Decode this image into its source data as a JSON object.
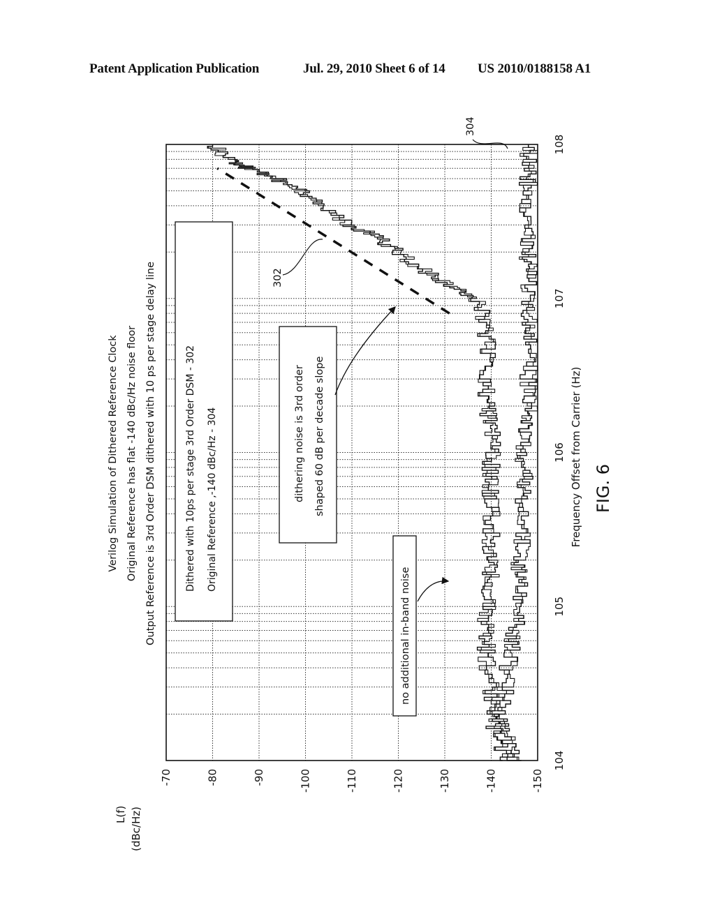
{
  "header": {
    "publication": "Patent Application Publication",
    "date_sheet": "Jul. 29, 2010   Sheet 6 of 14",
    "number": "US 2010/0188158 A1"
  },
  "figure_label": "FIG. 6",
  "chart_data": {
    "type": "line",
    "orientation": "rotated 90 degrees counter-clockwise",
    "title": [
      "Verilog Simulation of Dithered Reference Clock",
      "Original Reference has flat -140 dBc/Hz noise floor",
      "Output Reference is 3rd Order DSM dithered with 10 ps per stage delay line"
    ],
    "xlabel": "Frequency Offset from Carrier (Hz)",
    "ylabel": [
      "L(f)",
      "(dBc/Hz)"
    ],
    "xscale": "log",
    "xlim": [
      10000,
      100000000
    ],
    "ylim": [
      -150,
      -70
    ],
    "grid": true,
    "xticks": [
      {
        "value": 10000,
        "label": "104"
      },
      {
        "value": 100000,
        "label": "105"
      },
      {
        "value": 1000000,
        "label": "106"
      },
      {
        "value": 10000000,
        "label": "107"
      },
      {
        "value": 100000000,
        "label": "108"
      }
    ],
    "yticks": [
      {
        "value": -70,
        "label": "-70"
      },
      {
        "value": -80,
        "label": "-80"
      },
      {
        "value": -90,
        "label": "-90"
      },
      {
        "value": -100,
        "label": "-100"
      },
      {
        "value": -110,
        "label": "-110"
      },
      {
        "value": -120,
        "label": "-120"
      },
      {
        "value": -130,
        "label": "-130"
      },
      {
        "value": -140,
        "label": "-140"
      },
      {
        "value": -150,
        "label": "-150"
      }
    ],
    "legend": {
      "placement": "top-left",
      "entries": [
        "Dithered with 10ps per stage 3rd Order DSM - 302",
        "Original Reference ,-140  dBc/Hz - 304"
      ]
    },
    "series": [
      {
        "name": "Dithered with 10ps per stage 3rd Order DSM - 302",
        "ref": "302",
        "style": "stepped",
        "x": [
          10000,
          15000,
          20000,
          30000,
          50000,
          70000,
          100000,
          150000,
          200000,
          300000,
          500000,
          700000,
          1000000,
          1500000,
          2000000,
          3000000,
          5000000,
          7000000,
          10000000,
          12000000,
          15000000,
          20000000,
          25000000,
          30000000,
          40000000,
          50000000,
          60000000,
          70000000,
          80000000,
          100000000
        ],
        "y": [
          -144,
          -141,
          -140,
          -140,
          -139,
          -139,
          -139,
          -140,
          -140,
          -140,
          -140,
          -140,
          -140,
          -140,
          -139,
          -139,
          -139,
          -139,
          -137,
          -132,
          -126,
          -120,
          -116,
          -110,
          -104,
          -99,
          -94,
          -88,
          -84,
          -80
        ]
      },
      {
        "name": "Original Reference ,-140  dBc/Hz - 304",
        "ref": "304",
        "style": "stepped",
        "x": [
          10000,
          15000,
          20000,
          30000,
          50000,
          70000,
          100000,
          150000,
          200000,
          300000,
          500000,
          700000,
          1000000,
          1500000,
          2000000,
          3000000,
          5000000,
          7000000,
          10000000,
          15000000,
          20000000,
          30000000,
          50000000,
          70000000,
          100000000
        ],
        "y": [
          -145,
          -143,
          -142,
          -143,
          -144,
          -145,
          -146,
          -146,
          -146,
          -147,
          -147,
          -147,
          -147,
          -148,
          -148,
          -148,
          -148,
          -148,
          -148,
          -148,
          -148,
          -148,
          -148,
          -148,
          -148
        ]
      },
      {
        "name": "60 dB per decade slope",
        "style": "dashed",
        "x": [
          8000000,
          70000000
        ],
        "y": [
          -131,
          -81
        ]
      }
    ],
    "annotations": [
      {
        "text": "dithering noise is 3rd order shaped 60 dB per decade slope",
        "lines": [
          "dithering noise is 3rd order",
          "shaped 60 dB per decade slope"
        ],
        "points_to": "dashed slope line"
      },
      {
        "text": "no additional in-band noise",
        "points_to": "in-band noise region near 10^5 Hz"
      },
      {
        "text": "302",
        "points_to": "series 302"
      },
      {
        "text": "304",
        "points_to": "series 304"
      }
    ]
  }
}
